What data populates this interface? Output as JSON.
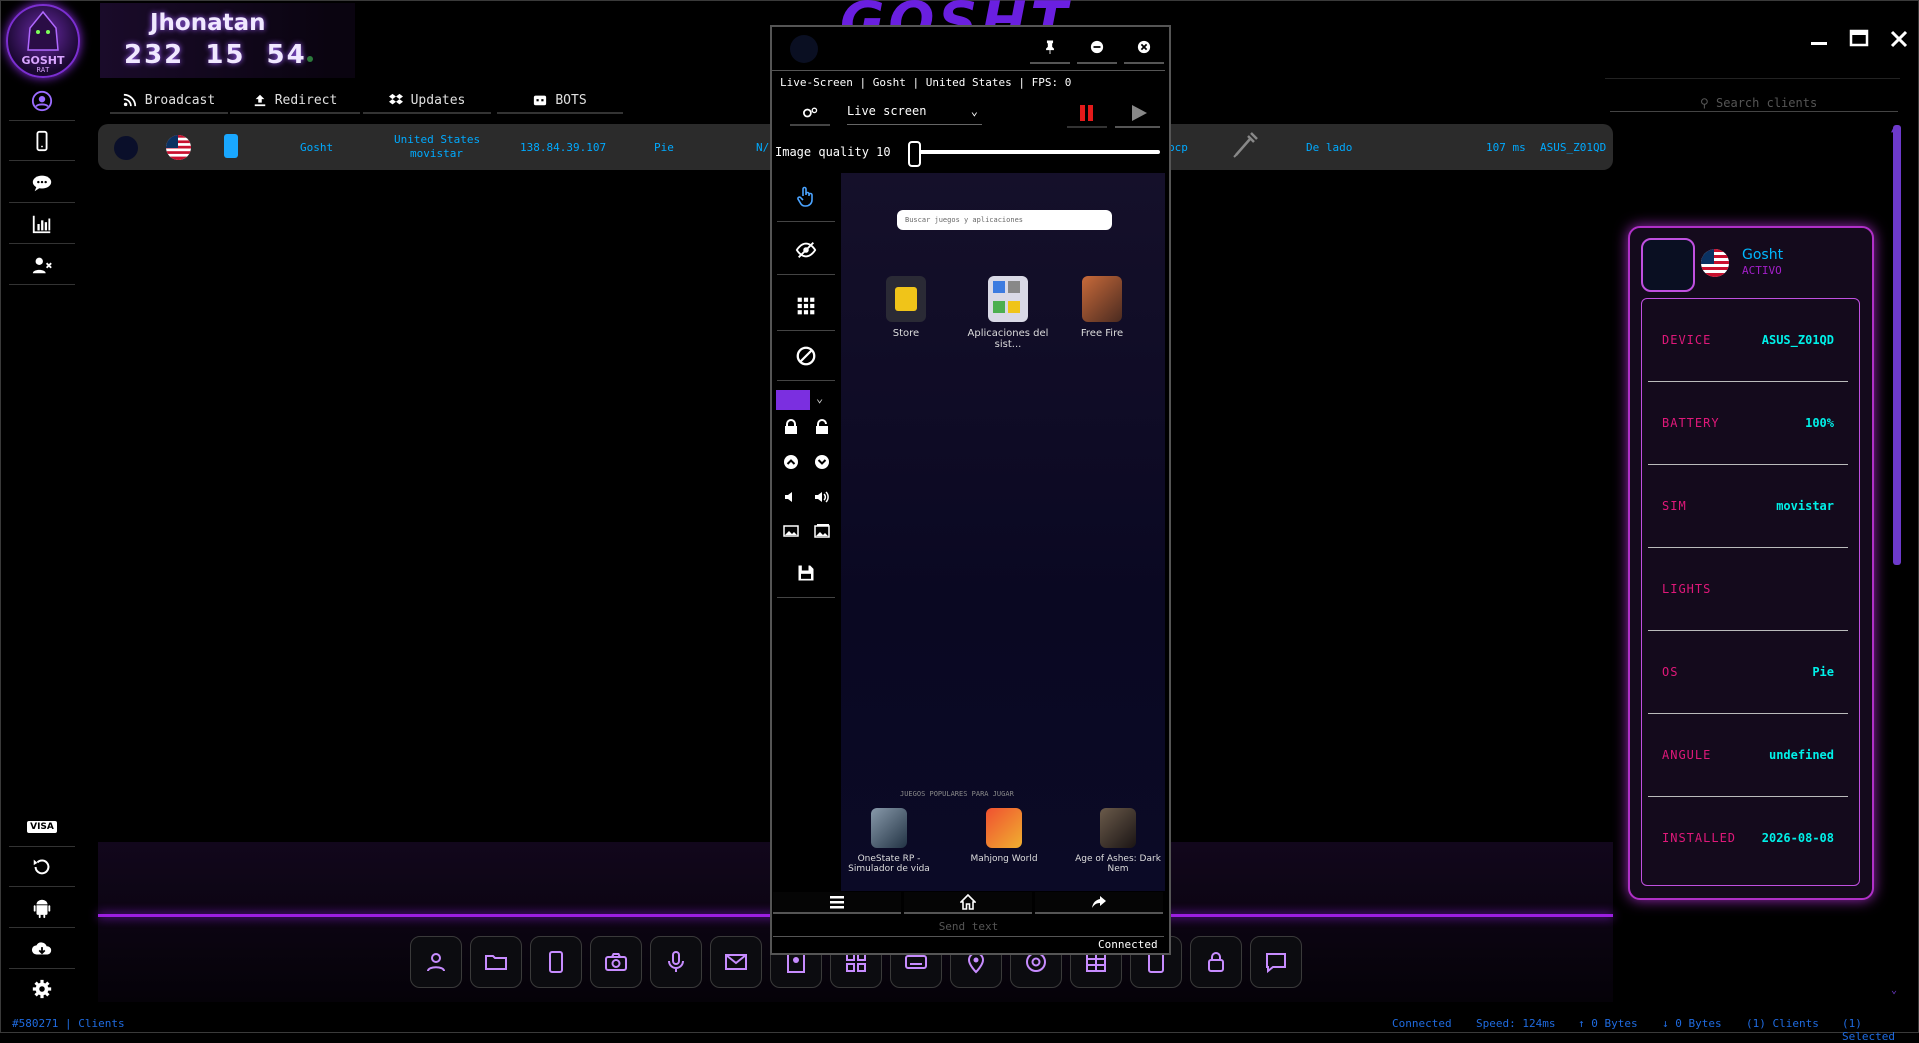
{
  "app": {
    "logo_text": "GOSHT",
    "logo_sub": "RAT",
    "background_title": "GOSHT"
  },
  "user": {
    "name": "Jhonatan",
    "numbers": "232 15 54"
  },
  "sidebar": {
    "top_items": [
      "user-icon",
      "phone-icon",
      "chat-icon",
      "chart-icon",
      "user-remove-icon"
    ],
    "bottom_items": [
      "visa-icon",
      "refresh-icon",
      "android-icon",
      "cloud-download-icon",
      "gear-icon"
    ],
    "visa_label": "VISA"
  },
  "tabs": [
    {
      "label": "Broadcast",
      "icon": "rss-icon"
    },
    {
      "label": "Redirect",
      "icon": "upload-icon"
    },
    {
      "label": "Updates",
      "icon": "dropbox-icon"
    },
    {
      "label": "BOTS",
      "icon": "robot-icon"
    }
  ],
  "search": {
    "placeholder": "Search clients"
  },
  "client": {
    "name": "Gosht",
    "country": "United States",
    "carrier": "movistar",
    "ip": "138.84.39.107",
    "os": "Pie",
    "na": "N/",
    "bcp": "bcp",
    "orientation": "De lado",
    "ping": "107 ms",
    "device": "ASUS_Z01QD"
  },
  "device_card": {
    "name": "Gosht",
    "status": "ACTIVO",
    "fields": [
      {
        "key": "DEVICE",
        "value": "ASUS_Z01QD"
      },
      {
        "key": "BATTERY",
        "value": "100%"
      },
      {
        "key": "SIM",
        "value": "movistar"
      },
      {
        "key": "LIGHTS",
        "value": ""
      },
      {
        "key": "OS",
        "value": "Pie"
      },
      {
        "key": "ANGULE",
        "value": "undefined"
      },
      {
        "key": "INSTALLED",
        "value": "2026-08-08"
      }
    ]
  },
  "live_screen": {
    "info": "Live-Screen | Gosht | United States | FPS: 0",
    "mode": "Live screen",
    "image_quality_label": "Image quality 10",
    "image_quality": 10,
    "color_swatch": "#7b2fe0",
    "phone_search": "Buscar juegos y aplicaciones",
    "apps": [
      {
        "label": "Store"
      },
      {
        "label": "Aplicaciones del sist..."
      },
      {
        "label": "Free Fire"
      }
    ],
    "popular_label": "JUEGOS POPULARES PARA JUGAR",
    "bottom_apps": [
      {
        "label": "OneState RP - Simulador de vida"
      },
      {
        "label": "Mahjong World"
      },
      {
        "label": "Age of Ashes: Dark Nem"
      }
    ],
    "send_text_placeholder": "Send text",
    "connection": "Connected"
  },
  "toolbar": [
    "user-icon",
    "folder-icon",
    "phone-icon",
    "camera-icon",
    "mic-icon",
    "mail-icon",
    "contacts-icon",
    "apps-icon",
    "keyboard-icon",
    "location-icon",
    "chrome-icon",
    "grid-icon",
    "tablet-icon",
    "lock-icon",
    "message-icon"
  ],
  "status_bar": {
    "session": "#580271 | Clients",
    "connected": "Connected",
    "speed": "Speed: 124ms",
    "up": "↑ 0 Bytes",
    "down": "↓ 0 Bytes",
    "clients": "(1) Clients",
    "selected": "(1) Selected"
  },
  "colors": {
    "accent": "#8a2be2",
    "client_text": "#00aaff",
    "card_key": "#e0187a",
    "card_value": "#00f0e8"
  }
}
